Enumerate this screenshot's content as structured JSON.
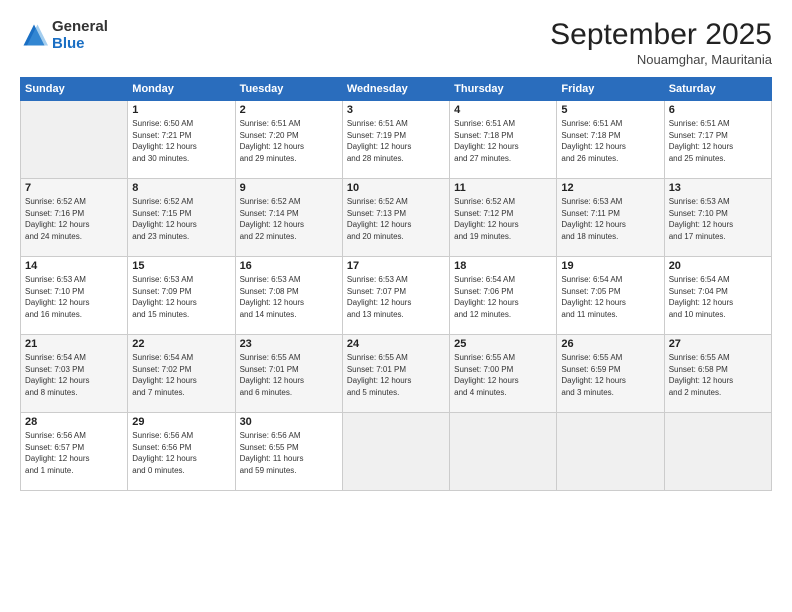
{
  "logo": {
    "general": "General",
    "blue": "Blue"
  },
  "title": "September 2025",
  "subtitle": "Nouamghar, Mauritania",
  "headers": [
    "Sunday",
    "Monday",
    "Tuesday",
    "Wednesday",
    "Thursday",
    "Friday",
    "Saturday"
  ],
  "weeks": [
    [
      {
        "day": "",
        "info": ""
      },
      {
        "day": "1",
        "info": "Sunrise: 6:50 AM\nSunset: 7:21 PM\nDaylight: 12 hours\nand 30 minutes."
      },
      {
        "day": "2",
        "info": "Sunrise: 6:51 AM\nSunset: 7:20 PM\nDaylight: 12 hours\nand 29 minutes."
      },
      {
        "day": "3",
        "info": "Sunrise: 6:51 AM\nSunset: 7:19 PM\nDaylight: 12 hours\nand 28 minutes."
      },
      {
        "day": "4",
        "info": "Sunrise: 6:51 AM\nSunset: 7:18 PM\nDaylight: 12 hours\nand 27 minutes."
      },
      {
        "day": "5",
        "info": "Sunrise: 6:51 AM\nSunset: 7:18 PM\nDaylight: 12 hours\nand 26 minutes."
      },
      {
        "day": "6",
        "info": "Sunrise: 6:51 AM\nSunset: 7:17 PM\nDaylight: 12 hours\nand 25 minutes."
      }
    ],
    [
      {
        "day": "7",
        "info": "Sunrise: 6:52 AM\nSunset: 7:16 PM\nDaylight: 12 hours\nand 24 minutes."
      },
      {
        "day": "8",
        "info": "Sunrise: 6:52 AM\nSunset: 7:15 PM\nDaylight: 12 hours\nand 23 minutes."
      },
      {
        "day": "9",
        "info": "Sunrise: 6:52 AM\nSunset: 7:14 PM\nDaylight: 12 hours\nand 22 minutes."
      },
      {
        "day": "10",
        "info": "Sunrise: 6:52 AM\nSunset: 7:13 PM\nDaylight: 12 hours\nand 20 minutes."
      },
      {
        "day": "11",
        "info": "Sunrise: 6:52 AM\nSunset: 7:12 PM\nDaylight: 12 hours\nand 19 minutes."
      },
      {
        "day": "12",
        "info": "Sunrise: 6:53 AM\nSunset: 7:11 PM\nDaylight: 12 hours\nand 18 minutes."
      },
      {
        "day": "13",
        "info": "Sunrise: 6:53 AM\nSunset: 7:10 PM\nDaylight: 12 hours\nand 17 minutes."
      }
    ],
    [
      {
        "day": "14",
        "info": "Sunrise: 6:53 AM\nSunset: 7:10 PM\nDaylight: 12 hours\nand 16 minutes."
      },
      {
        "day": "15",
        "info": "Sunrise: 6:53 AM\nSunset: 7:09 PM\nDaylight: 12 hours\nand 15 minutes."
      },
      {
        "day": "16",
        "info": "Sunrise: 6:53 AM\nSunset: 7:08 PM\nDaylight: 12 hours\nand 14 minutes."
      },
      {
        "day": "17",
        "info": "Sunrise: 6:53 AM\nSunset: 7:07 PM\nDaylight: 12 hours\nand 13 minutes."
      },
      {
        "day": "18",
        "info": "Sunrise: 6:54 AM\nSunset: 7:06 PM\nDaylight: 12 hours\nand 12 minutes."
      },
      {
        "day": "19",
        "info": "Sunrise: 6:54 AM\nSunset: 7:05 PM\nDaylight: 12 hours\nand 11 minutes."
      },
      {
        "day": "20",
        "info": "Sunrise: 6:54 AM\nSunset: 7:04 PM\nDaylight: 12 hours\nand 10 minutes."
      }
    ],
    [
      {
        "day": "21",
        "info": "Sunrise: 6:54 AM\nSunset: 7:03 PM\nDaylight: 12 hours\nand 8 minutes."
      },
      {
        "day": "22",
        "info": "Sunrise: 6:54 AM\nSunset: 7:02 PM\nDaylight: 12 hours\nand 7 minutes."
      },
      {
        "day": "23",
        "info": "Sunrise: 6:55 AM\nSunset: 7:01 PM\nDaylight: 12 hours\nand 6 minutes."
      },
      {
        "day": "24",
        "info": "Sunrise: 6:55 AM\nSunset: 7:01 PM\nDaylight: 12 hours\nand 5 minutes."
      },
      {
        "day": "25",
        "info": "Sunrise: 6:55 AM\nSunset: 7:00 PM\nDaylight: 12 hours\nand 4 minutes."
      },
      {
        "day": "26",
        "info": "Sunrise: 6:55 AM\nSunset: 6:59 PM\nDaylight: 12 hours\nand 3 minutes."
      },
      {
        "day": "27",
        "info": "Sunrise: 6:55 AM\nSunset: 6:58 PM\nDaylight: 12 hours\nand 2 minutes."
      }
    ],
    [
      {
        "day": "28",
        "info": "Sunrise: 6:56 AM\nSunset: 6:57 PM\nDaylight: 12 hours\nand 1 minute."
      },
      {
        "day": "29",
        "info": "Sunrise: 6:56 AM\nSunset: 6:56 PM\nDaylight: 12 hours\nand 0 minutes."
      },
      {
        "day": "30",
        "info": "Sunrise: 6:56 AM\nSunset: 6:55 PM\nDaylight: 11 hours\nand 59 minutes."
      },
      {
        "day": "",
        "info": ""
      },
      {
        "day": "",
        "info": ""
      },
      {
        "day": "",
        "info": ""
      },
      {
        "day": "",
        "info": ""
      }
    ]
  ]
}
